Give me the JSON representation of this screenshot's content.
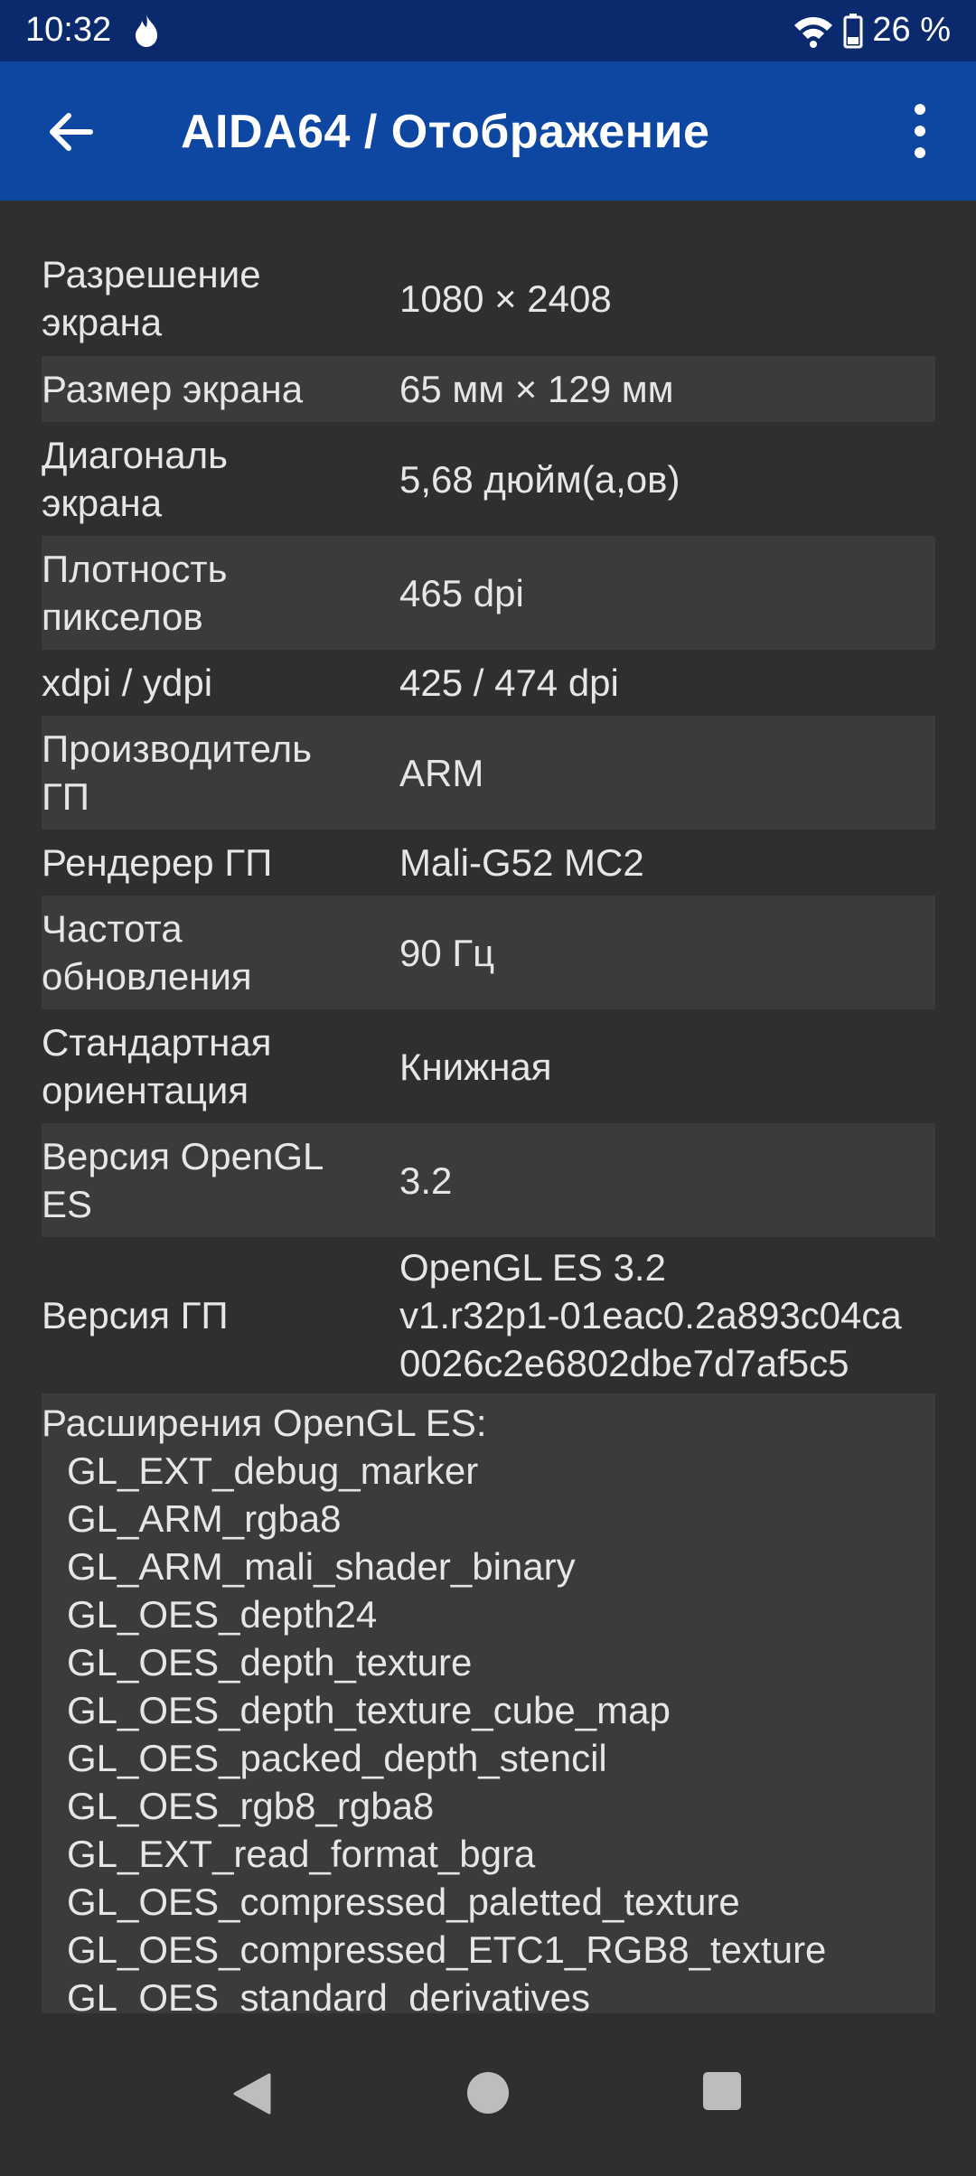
{
  "status_bar": {
    "time": "10:32",
    "battery": "26 %",
    "icons": [
      "flame-icon",
      "wifi-icon",
      "battery-icon"
    ]
  },
  "app_bar": {
    "title": "AIDA64  /  Отображение",
    "icons": [
      "back-arrow-icon",
      "overflow-menu-icon"
    ]
  },
  "rows": [
    {
      "label": "Разрешение\nэкрана",
      "value": "1080 × 2408"
    },
    {
      "label": "Размер экрана",
      "value": "65 мм × 129 мм"
    },
    {
      "label": "Диагональ\nэкрана",
      "value": "5,68 дюйм(а,ов)"
    },
    {
      "label": "Плотность\nпикселов",
      "value": "465 dpi"
    },
    {
      "label": "xdpi / ydpi",
      "value": "425 / 474 dpi"
    },
    {
      "label": "Производитель\nГП",
      "value": "ARM"
    },
    {
      "label": "Рендерер ГП",
      "value": "Mali-G52 MC2"
    },
    {
      "label": "Частота\nобновления",
      "value": "90 Гц"
    },
    {
      "label": "Стандартная\nориентация",
      "value": "Книжная"
    },
    {
      "label": "Версия OpenGL\nES",
      "value": "3.2"
    },
    {
      "label": "Версия ГП",
      "value": "OpenGL ES 3.2\nv1.r32p1-01eac0.2a893c04ca\n0026c2e6802dbe7d7af5c5"
    }
  ],
  "extensions": {
    "header": "Расширения OpenGL ES:",
    "items": [
      "GL_EXT_debug_marker",
      "GL_ARM_rgba8",
      "GL_ARM_mali_shader_binary",
      "GL_OES_depth24",
      "GL_OES_depth_texture",
      "GL_OES_depth_texture_cube_map",
      "GL_OES_packed_depth_stencil",
      "GL_OES_rgb8_rgba8",
      "GL_EXT_read_format_bgra",
      "GL_OES_compressed_paletted_texture",
      "GL_OES_compressed_ETC1_RGB8_texture",
      "GL_OES_standard_derivatives"
    ]
  },
  "nav_bar": {
    "icons": [
      "nav-back-icon",
      "nav-home-icon",
      "nav-recents-icon"
    ]
  },
  "colors": {
    "status_bar": "#0b2a6e",
    "app_bar": "#0d47a1",
    "background": "#2f2f2f",
    "row_alt": "#3b3b3b"
  }
}
